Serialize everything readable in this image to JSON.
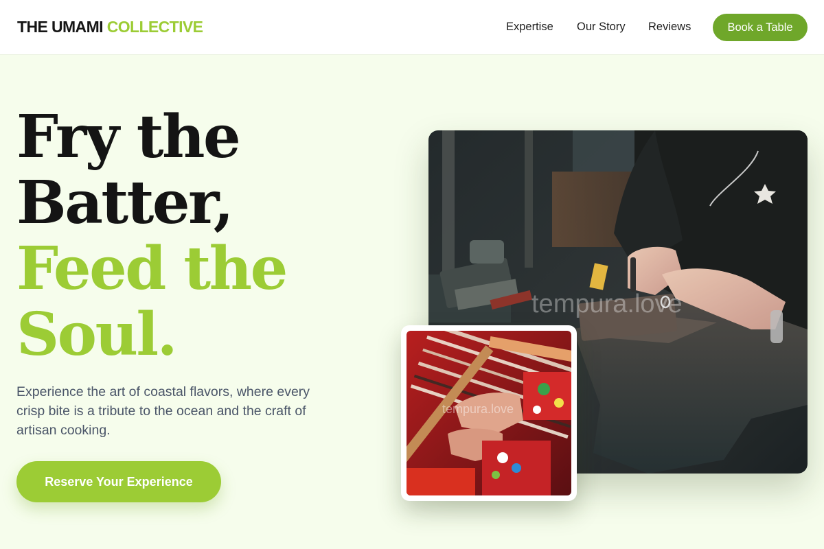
{
  "header": {
    "logo_primary": "THE UMAMI",
    "logo_accent": "COLLECTIVE",
    "nav": [
      "Expertise",
      "Our Story",
      "Reviews"
    ],
    "cta_label": "Book a Table"
  },
  "hero": {
    "title_lines": [
      "Fry the",
      "Batter,"
    ],
    "title_accent_lines": [
      "Feed the",
      "Soul."
    ],
    "description": "Experience the art of coastal flavors, where every crisp bite is a tribute to the ocean and the craft of artisan cooking.",
    "cta_label": "Reserve Your Experience"
  },
  "images": {
    "main_watermark": "tempura.love",
    "small_watermark": "tempura.love"
  },
  "colors": {
    "accent": "#9ccc35",
    "button_dark_green": "#6fa72a",
    "background": "#f6fdec"
  }
}
